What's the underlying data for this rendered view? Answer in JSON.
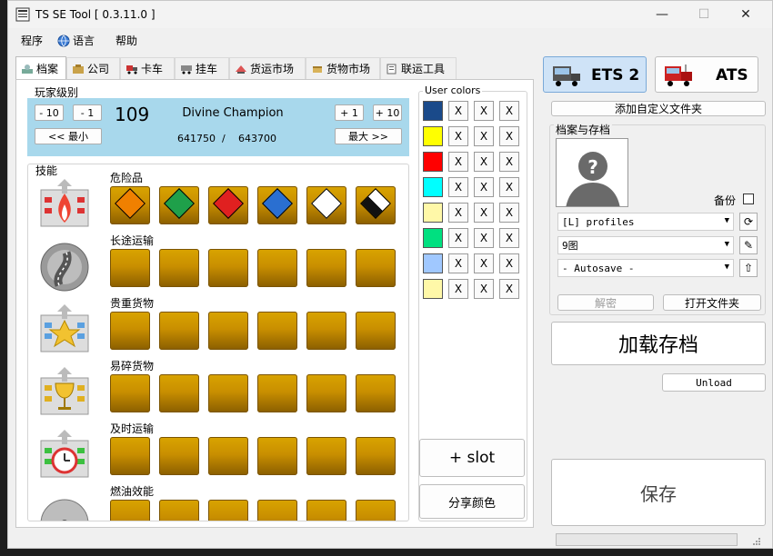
{
  "window": {
    "title": "TS SE Tool [ 0.3.11.0 ]",
    "controls": {
      "minimize": "—",
      "maximize": "☐",
      "close": "✕"
    }
  },
  "menu": {
    "program": "程序",
    "language": "语言",
    "help": "帮助"
  },
  "tabs": [
    {
      "label": "档案",
      "icon": "profile-icon"
    },
    {
      "label": "公司",
      "icon": "company-icon"
    },
    {
      "label": "卡车",
      "icon": "truck-icon"
    },
    {
      "label": "挂车",
      "icon": "trailer-icon"
    },
    {
      "label": "货运市场",
      "icon": "freight-market-icon"
    },
    {
      "label": "货物市场",
      "icon": "cargo-market-icon"
    },
    {
      "label": "联运工具",
      "icon": "convoy-tools-icon"
    }
  ],
  "player_level": {
    "label": "玩家级别",
    "level": "109",
    "title": "Divine Champion",
    "xp_current": "641750",
    "separator": "/",
    "xp_next": "643700",
    "buttons": {
      "minus10": "- 10",
      "minus1": "- 1",
      "plus1": "+ 1",
      "plus10": "+ 10",
      "min": "<< 最小",
      "max": "最大 >>"
    }
  },
  "skills": {
    "label": "技能",
    "rows": [
      {
        "name": "危险品",
        "icon": "hazardous-cargo-icon",
        "levels": 6,
        "slot_icons": [
          "explosives-icon",
          "gas-icon",
          "toxic-icon",
          "flammable-liquid-icon",
          "infectious-icon",
          "corrosive-icon"
        ]
      },
      {
        "name": "长途运输",
        "icon": "long-distance-icon",
        "levels": 0
      },
      {
        "name": "贵重货物",
        "icon": "valuable-cargo-icon",
        "levels": 0
      },
      {
        "name": "易碎货物",
        "icon": "fragile-cargo-icon",
        "levels": 0
      },
      {
        "name": "及时运输",
        "icon": "just-in-time-icon",
        "levels": 0
      },
      {
        "name": "燃油效能",
        "icon": "fuel-economy-icon",
        "levels": 0
      }
    ]
  },
  "user_colors": {
    "label": "User colors",
    "swatches": [
      "#1a4a8a",
      "#ffff00",
      "#ff0000",
      "#00ffff",
      "#fff8a8",
      "#00e080",
      "#a0c8ff",
      "#fff8a8"
    ],
    "clear_label": "X",
    "add_slot": "+ slot",
    "share": "分享颜色"
  },
  "game_select": {
    "ets2": "ETS 2",
    "ats": "ATS"
  },
  "add_folder": "添加自定义文件夹",
  "profiles": {
    "label": "档案与存档",
    "backup_label": "备份",
    "profile_combo": "[L] profiles",
    "profile_name": "9图",
    "save_combo": "- Autosave -",
    "decrypt": "解密",
    "open_folder": "打开文件夹"
  },
  "load_save": "加载存档",
  "unload": "Unload",
  "save": "保存"
}
